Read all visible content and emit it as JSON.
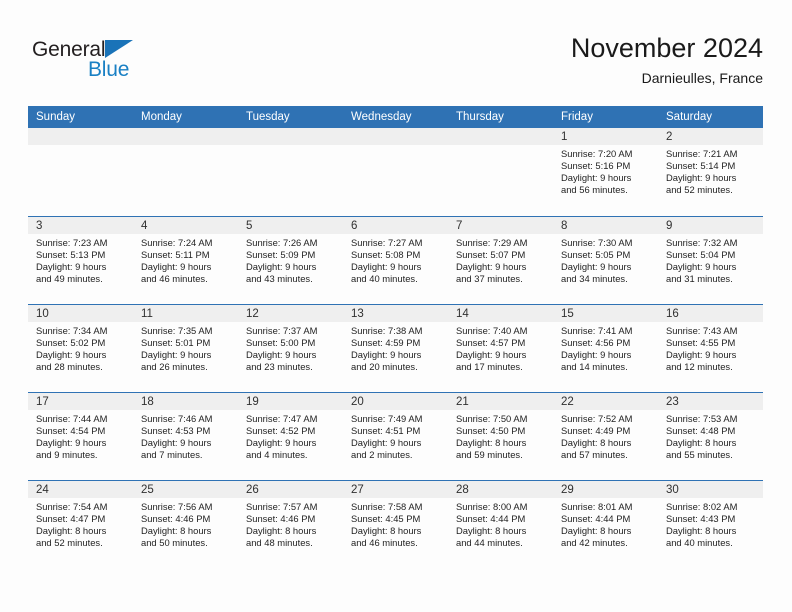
{
  "brand": {
    "name_part1": "General",
    "name_part2": "Blue",
    "triangle_color": "#1a73b8",
    "blue_color": "#1a80c4"
  },
  "header": {
    "title": "November 2024",
    "subtitle": "Darnieulles, France"
  },
  "colors": {
    "header_blue": "#2f72b4",
    "day_band_gray": "#efefef",
    "row_rule": "#2f72b4"
  },
  "weekdays": [
    "Sunday",
    "Monday",
    "Tuesday",
    "Wednesday",
    "Thursday",
    "Friday",
    "Saturday"
  ],
  "weeks": [
    [
      {
        "day": "",
        "sunrise": "",
        "sunset": "",
        "daylight1": "",
        "daylight2": ""
      },
      {
        "day": "",
        "sunrise": "",
        "sunset": "",
        "daylight1": "",
        "daylight2": ""
      },
      {
        "day": "",
        "sunrise": "",
        "sunset": "",
        "daylight1": "",
        "daylight2": ""
      },
      {
        "day": "",
        "sunrise": "",
        "sunset": "",
        "daylight1": "",
        "daylight2": ""
      },
      {
        "day": "",
        "sunrise": "",
        "sunset": "",
        "daylight1": "",
        "daylight2": ""
      },
      {
        "day": "1",
        "sunrise": "Sunrise: 7:20 AM",
        "sunset": "Sunset: 5:16 PM",
        "daylight1": "Daylight: 9 hours",
        "daylight2": "and 56 minutes."
      },
      {
        "day": "2",
        "sunrise": "Sunrise: 7:21 AM",
        "sunset": "Sunset: 5:14 PM",
        "daylight1": "Daylight: 9 hours",
        "daylight2": "and 52 minutes."
      }
    ],
    [
      {
        "day": "3",
        "sunrise": "Sunrise: 7:23 AM",
        "sunset": "Sunset: 5:13 PM",
        "daylight1": "Daylight: 9 hours",
        "daylight2": "and 49 minutes."
      },
      {
        "day": "4",
        "sunrise": "Sunrise: 7:24 AM",
        "sunset": "Sunset: 5:11 PM",
        "daylight1": "Daylight: 9 hours",
        "daylight2": "and 46 minutes."
      },
      {
        "day": "5",
        "sunrise": "Sunrise: 7:26 AM",
        "sunset": "Sunset: 5:09 PM",
        "daylight1": "Daylight: 9 hours",
        "daylight2": "and 43 minutes."
      },
      {
        "day": "6",
        "sunrise": "Sunrise: 7:27 AM",
        "sunset": "Sunset: 5:08 PM",
        "daylight1": "Daylight: 9 hours",
        "daylight2": "and 40 minutes."
      },
      {
        "day": "7",
        "sunrise": "Sunrise: 7:29 AM",
        "sunset": "Sunset: 5:07 PM",
        "daylight1": "Daylight: 9 hours",
        "daylight2": "and 37 minutes."
      },
      {
        "day": "8",
        "sunrise": "Sunrise: 7:30 AM",
        "sunset": "Sunset: 5:05 PM",
        "daylight1": "Daylight: 9 hours",
        "daylight2": "and 34 minutes."
      },
      {
        "day": "9",
        "sunrise": "Sunrise: 7:32 AM",
        "sunset": "Sunset: 5:04 PM",
        "daylight1": "Daylight: 9 hours",
        "daylight2": "and 31 minutes."
      }
    ],
    [
      {
        "day": "10",
        "sunrise": "Sunrise: 7:34 AM",
        "sunset": "Sunset: 5:02 PM",
        "daylight1": "Daylight: 9 hours",
        "daylight2": "and 28 minutes."
      },
      {
        "day": "11",
        "sunrise": "Sunrise: 7:35 AM",
        "sunset": "Sunset: 5:01 PM",
        "daylight1": "Daylight: 9 hours",
        "daylight2": "and 26 minutes."
      },
      {
        "day": "12",
        "sunrise": "Sunrise: 7:37 AM",
        "sunset": "Sunset: 5:00 PM",
        "daylight1": "Daylight: 9 hours",
        "daylight2": "and 23 minutes."
      },
      {
        "day": "13",
        "sunrise": "Sunrise: 7:38 AM",
        "sunset": "Sunset: 4:59 PM",
        "daylight1": "Daylight: 9 hours",
        "daylight2": "and 20 minutes."
      },
      {
        "day": "14",
        "sunrise": "Sunrise: 7:40 AM",
        "sunset": "Sunset: 4:57 PM",
        "daylight1": "Daylight: 9 hours",
        "daylight2": "and 17 minutes."
      },
      {
        "day": "15",
        "sunrise": "Sunrise: 7:41 AM",
        "sunset": "Sunset: 4:56 PM",
        "daylight1": "Daylight: 9 hours",
        "daylight2": "and 14 minutes."
      },
      {
        "day": "16",
        "sunrise": "Sunrise: 7:43 AM",
        "sunset": "Sunset: 4:55 PM",
        "daylight1": "Daylight: 9 hours",
        "daylight2": "and 12 minutes."
      }
    ],
    [
      {
        "day": "17",
        "sunrise": "Sunrise: 7:44 AM",
        "sunset": "Sunset: 4:54 PM",
        "daylight1": "Daylight: 9 hours",
        "daylight2": "and 9 minutes."
      },
      {
        "day": "18",
        "sunrise": "Sunrise: 7:46 AM",
        "sunset": "Sunset: 4:53 PM",
        "daylight1": "Daylight: 9 hours",
        "daylight2": "and 7 minutes."
      },
      {
        "day": "19",
        "sunrise": "Sunrise: 7:47 AM",
        "sunset": "Sunset: 4:52 PM",
        "daylight1": "Daylight: 9 hours",
        "daylight2": "and 4 minutes."
      },
      {
        "day": "20",
        "sunrise": "Sunrise: 7:49 AM",
        "sunset": "Sunset: 4:51 PM",
        "daylight1": "Daylight: 9 hours",
        "daylight2": "and 2 minutes."
      },
      {
        "day": "21",
        "sunrise": "Sunrise: 7:50 AM",
        "sunset": "Sunset: 4:50 PM",
        "daylight1": "Daylight: 8 hours",
        "daylight2": "and 59 minutes."
      },
      {
        "day": "22",
        "sunrise": "Sunrise: 7:52 AM",
        "sunset": "Sunset: 4:49 PM",
        "daylight1": "Daylight: 8 hours",
        "daylight2": "and 57 minutes."
      },
      {
        "day": "23",
        "sunrise": "Sunrise: 7:53 AM",
        "sunset": "Sunset: 4:48 PM",
        "daylight1": "Daylight: 8 hours",
        "daylight2": "and 55 minutes."
      }
    ],
    [
      {
        "day": "24",
        "sunrise": "Sunrise: 7:54 AM",
        "sunset": "Sunset: 4:47 PM",
        "daylight1": "Daylight: 8 hours",
        "daylight2": "and 52 minutes."
      },
      {
        "day": "25",
        "sunrise": "Sunrise: 7:56 AM",
        "sunset": "Sunset: 4:46 PM",
        "daylight1": "Daylight: 8 hours",
        "daylight2": "and 50 minutes."
      },
      {
        "day": "26",
        "sunrise": "Sunrise: 7:57 AM",
        "sunset": "Sunset: 4:46 PM",
        "daylight1": "Daylight: 8 hours",
        "daylight2": "and 48 minutes."
      },
      {
        "day": "27",
        "sunrise": "Sunrise: 7:58 AM",
        "sunset": "Sunset: 4:45 PM",
        "daylight1": "Daylight: 8 hours",
        "daylight2": "and 46 minutes."
      },
      {
        "day": "28",
        "sunrise": "Sunrise: 8:00 AM",
        "sunset": "Sunset: 4:44 PM",
        "daylight1": "Daylight: 8 hours",
        "daylight2": "and 44 minutes."
      },
      {
        "day": "29",
        "sunrise": "Sunrise: 8:01 AM",
        "sunset": "Sunset: 4:44 PM",
        "daylight1": "Daylight: 8 hours",
        "daylight2": "and 42 minutes."
      },
      {
        "day": "30",
        "sunrise": "Sunrise: 8:02 AM",
        "sunset": "Sunset: 4:43 PM",
        "daylight1": "Daylight: 8 hours",
        "daylight2": "and 40 minutes."
      }
    ]
  ]
}
